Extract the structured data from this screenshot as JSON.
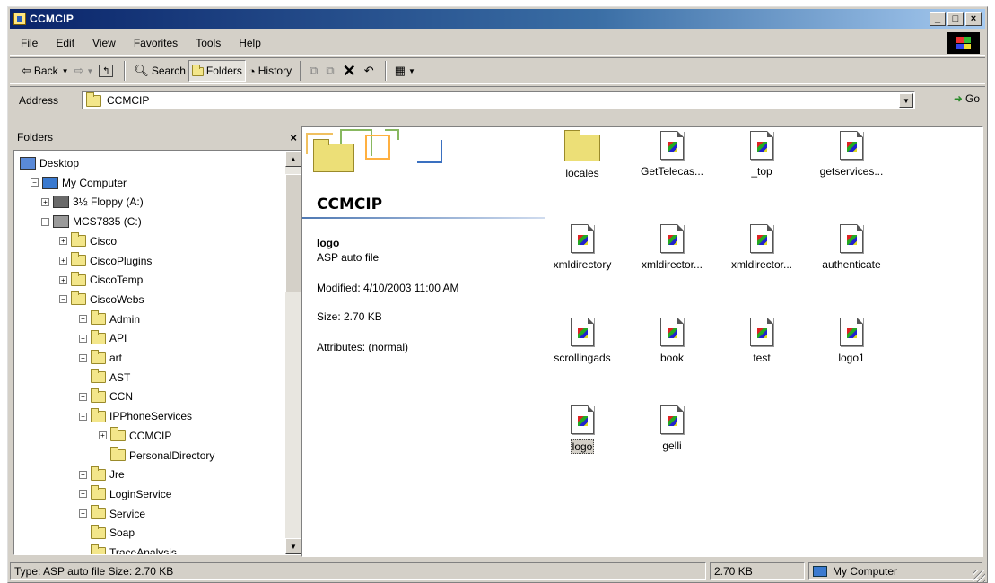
{
  "window": {
    "title": "CCMCIP",
    "min": "_",
    "max": "□",
    "close": "×"
  },
  "menu": [
    "File",
    "Edit",
    "View",
    "Favorites",
    "Tools",
    "Help"
  ],
  "toolbar": {
    "back": "Back",
    "search": "Search",
    "folders": "Folders",
    "history": "History"
  },
  "address": {
    "label": "Address",
    "value": "CCMCIP",
    "go": "Go"
  },
  "folders_pane": {
    "title": "Folders",
    "close": "×",
    "tree": [
      {
        "label": "Desktop",
        "level": 0,
        "kind": "desktop",
        "expander": ""
      },
      {
        "label": "My Computer",
        "level": 1,
        "kind": "computer",
        "expander": "−"
      },
      {
        "label": "3½ Floppy (A:)",
        "level": 2,
        "kind": "floppy",
        "expander": "+"
      },
      {
        "label": "MCS7835 (C:)",
        "level": 2,
        "kind": "drive",
        "expander": "−"
      },
      {
        "label": "Cisco",
        "level": 3,
        "kind": "folder",
        "expander": "+"
      },
      {
        "label": "CiscoPlugins",
        "level": 3,
        "kind": "folder",
        "expander": "+"
      },
      {
        "label": "CiscoTemp",
        "level": 3,
        "kind": "folder",
        "expander": "+"
      },
      {
        "label": "CiscoWebs",
        "level": 3,
        "kind": "folder",
        "expander": "−"
      },
      {
        "label": "Admin",
        "level": 4,
        "kind": "folder",
        "expander": "+"
      },
      {
        "label": "API",
        "level": 4,
        "kind": "folder",
        "expander": "+"
      },
      {
        "label": "art",
        "level": 4,
        "kind": "folder",
        "expander": "+"
      },
      {
        "label": "AST",
        "level": 4,
        "kind": "folder",
        "expander": ""
      },
      {
        "label": "CCN",
        "level": 4,
        "kind": "folder",
        "expander": "+"
      },
      {
        "label": "IPPhoneServices",
        "level": 4,
        "kind": "folder",
        "expander": "−"
      },
      {
        "label": "CCMCIP",
        "level": 5,
        "kind": "folder-open",
        "expander": "+"
      },
      {
        "label": "PersonalDirectory",
        "level": 5,
        "kind": "folder",
        "expander": ""
      },
      {
        "label": "Jre",
        "level": 4,
        "kind": "folder",
        "expander": "+"
      },
      {
        "label": "LoginService",
        "level": 4,
        "kind": "folder",
        "expander": "+"
      },
      {
        "label": "Service",
        "level": 4,
        "kind": "folder",
        "expander": "+"
      },
      {
        "label": "Soap",
        "level": 4,
        "kind": "folder",
        "expander": ""
      },
      {
        "label": "TraceAnalysis",
        "level": 4,
        "kind": "folder",
        "expander": ""
      }
    ]
  },
  "details": {
    "folder_title": "CCMCIP",
    "selected_name": "logo",
    "selected_type": "ASP auto file",
    "modified": "Modified: 4/10/2003 11:00 AM",
    "size": "Size: 2.70 KB",
    "attributes": "Attributes: (normal)"
  },
  "files": [
    {
      "label": "locales",
      "kind": "folder"
    },
    {
      "label": "GetTelecas...",
      "kind": "asp"
    },
    {
      "label": "_top",
      "kind": "asp"
    },
    {
      "label": "getservices...",
      "kind": "asp"
    },
    {
      "label": "xmldirectory",
      "kind": "asp"
    },
    {
      "label": "xmldirector...",
      "kind": "asp"
    },
    {
      "label": "xmldirector...",
      "kind": "asp"
    },
    {
      "label": "authenticate",
      "kind": "asp"
    },
    {
      "label": "scrollingads",
      "kind": "asp"
    },
    {
      "label": "book",
      "kind": "asp"
    },
    {
      "label": "test",
      "kind": "asp"
    },
    {
      "label": "logo1",
      "kind": "asp"
    },
    {
      "label": "logo",
      "kind": "asp",
      "selected": true
    },
    {
      "label": "gelli",
      "kind": "asp"
    }
  ],
  "status": {
    "left": "Type: ASP auto file Size: 2.70 KB",
    "size": "2.70 KB",
    "zone": "My Computer"
  }
}
